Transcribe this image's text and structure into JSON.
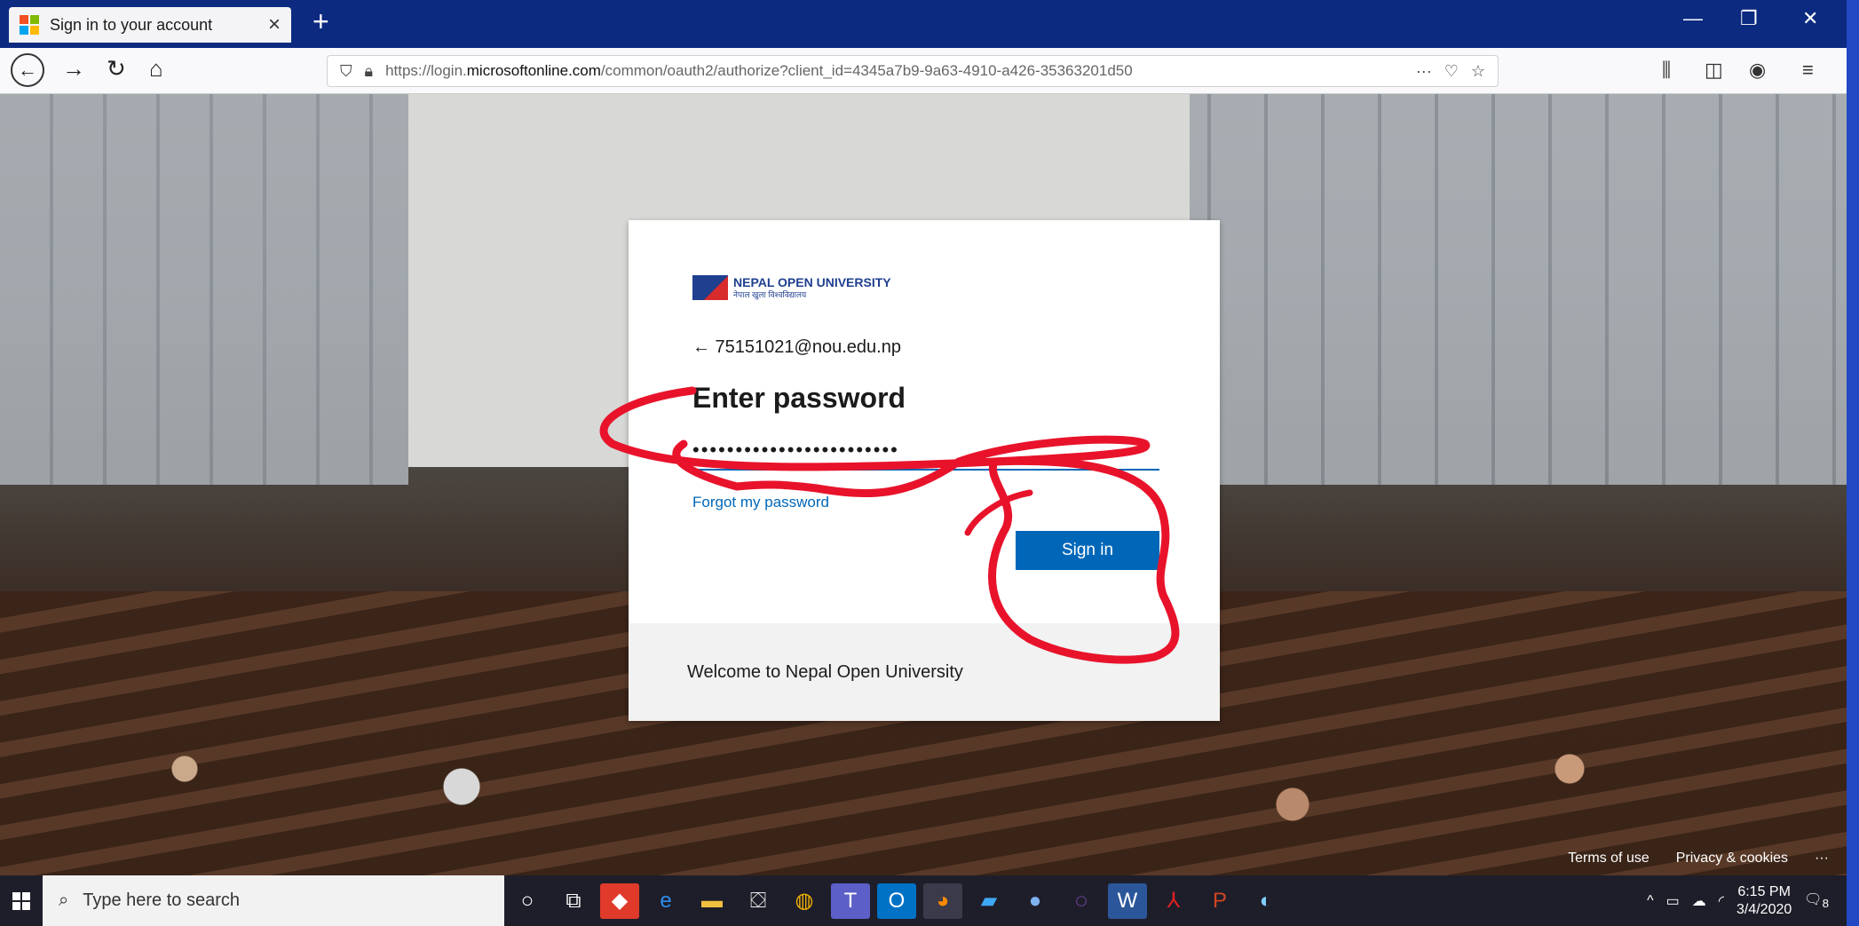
{
  "browser": {
    "tab_title": "Sign in to your account",
    "tab_close": "×",
    "new_tab": "+",
    "url_prefix": "https://login.",
    "url_domain": "microsoftonline.com",
    "url_path": "/common/oauth2/authorize?client_id=4345a7b9-9a63-4910-a426-35363201d50",
    "more": "···"
  },
  "card": {
    "org_name": "NEPAL OPEN UNIVERSITY",
    "org_sub": "नेपाल खुला विश्वविद्यालय",
    "identity": "← 75151021@nou.edu.np",
    "heading": "Enter password",
    "password_value": "••••••••••••••••••••••••",
    "forgot_link": "Forgot my password",
    "signin_label": "Sign in",
    "footer_text": "Welcome to Nepal Open University"
  },
  "page_footer": {
    "terms": "Terms of use",
    "privacy": "Privacy & cookies",
    "more": "···"
  },
  "taskbar": {
    "search_placeholder": "Type here to search",
    "time": "6:15 PM",
    "date": "3/4/2020",
    "notifications": "8"
  },
  "colors": {
    "accent": "#0067b8",
    "annotation": "#e8132b"
  }
}
